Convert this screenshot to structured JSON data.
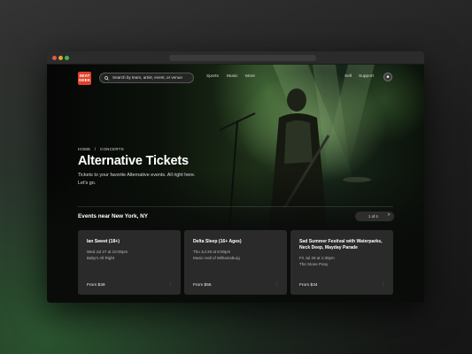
{
  "brand": {
    "logo_text": "SEAT GEEK",
    "accent": "#e0402a"
  },
  "search": {
    "placeholder": "Search by team, artist, event, or venue",
    "icon": "search-icon"
  },
  "nav": {
    "left_links": [
      "Sports",
      "Music",
      "More"
    ],
    "right_links": [
      "Sell",
      "Support"
    ],
    "account_icon": "user-icon"
  },
  "hero": {
    "breadcrumb": [
      "HOME",
      "/",
      "CONCERTS"
    ],
    "title": "Alternative Tickets",
    "subtitle": "Tickets to your favorite Alternative events. All right here. Let's go."
  },
  "events": {
    "section_title": "Events near New York, NY",
    "pager_text": "1 of 4",
    "next_icon": "chevron-right-icon",
    "cards": [
      {
        "title": "Ian Sweet (18+)",
        "date": "Wed Jul 27 at 10:00pm",
        "venue": "Baby's All Right",
        "price": "From $39"
      },
      {
        "title": "Delta Sleep (16+ Ages)",
        "date": "Thu Jul 28 at 8:00pm",
        "venue": "Music Hall of Williamsburg",
        "price": "From $56"
      },
      {
        "title": "Sad Summer Festival with Waterparks, Neck Deep, Mayday Parade",
        "date": "Fri Jul 29 at 1:30pm",
        "venue": "The Stone Pony",
        "price": "From $34"
      }
    ]
  }
}
